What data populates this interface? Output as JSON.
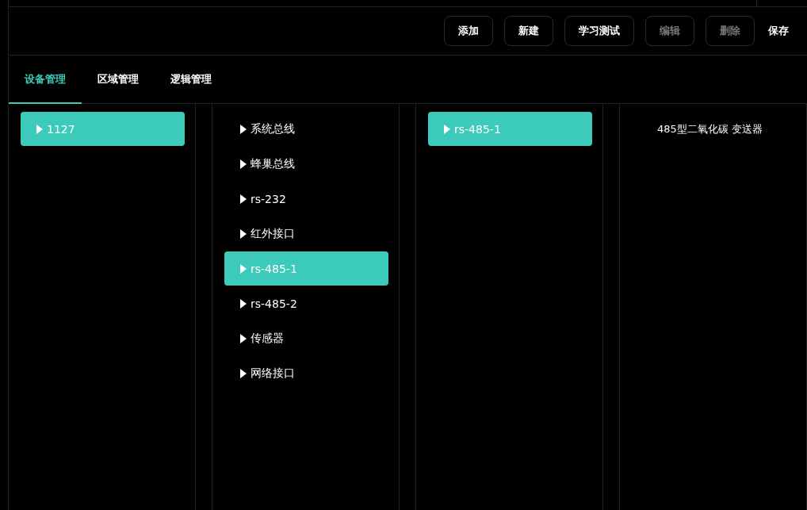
{
  "toolbar": {
    "buttons": [
      {
        "label": "添加",
        "disabled": false,
        "kind": "outlined"
      },
      {
        "label": "新建",
        "disabled": false,
        "kind": "outlined"
      },
      {
        "label": "学习测试",
        "disabled": false,
        "kind": "outlined"
      },
      {
        "label": "编辑",
        "disabled": true,
        "kind": "outlined"
      },
      {
        "label": "删除",
        "disabled": true,
        "kind": "outlined"
      },
      {
        "label": "保存",
        "disabled": false,
        "kind": "plain"
      }
    ]
  },
  "tabs": [
    {
      "label": "设备管理",
      "selected": true
    },
    {
      "label": "区域管理",
      "selected": false
    },
    {
      "label": "逻辑管理",
      "selected": false
    }
  ],
  "columns": [
    {
      "items": [
        {
          "label": "1127",
          "selected": true,
          "kind": "branch"
        }
      ]
    },
    {
      "items": [
        {
          "label": "系统总线",
          "selected": false,
          "kind": "branch"
        },
        {
          "label": "蜂巢总线",
          "selected": false,
          "kind": "branch"
        },
        {
          "label": "rs-232",
          "selected": false,
          "kind": "branch"
        },
        {
          "label": "红外接口",
          "selected": false,
          "kind": "branch"
        },
        {
          "label": "rs-485-1",
          "selected": true,
          "kind": "branch"
        },
        {
          "label": "rs-485-2",
          "selected": false,
          "kind": "branch"
        },
        {
          "label": "传感器",
          "selected": false,
          "kind": "branch"
        },
        {
          "label": "网络接口",
          "selected": false,
          "kind": "branch"
        }
      ]
    },
    {
      "items": [
        {
          "label": "rs-485-1",
          "selected": true,
          "kind": "branch"
        }
      ]
    },
    {
      "items": [
        {
          "label": "485型二氧化碳 变送器",
          "selected": false,
          "kind": "leaf"
        }
      ]
    }
  ]
}
